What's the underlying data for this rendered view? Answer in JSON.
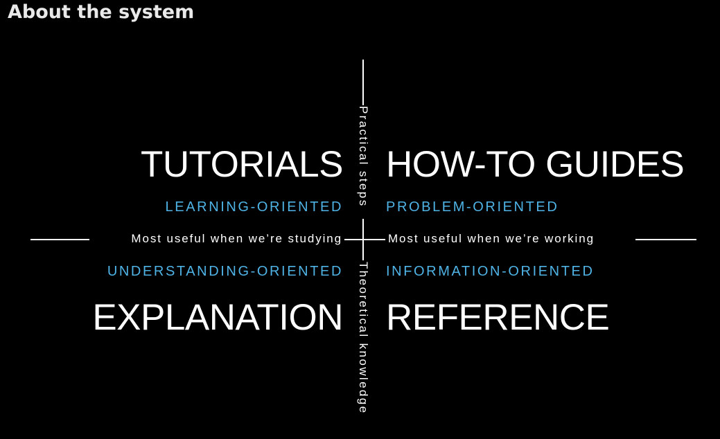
{
  "page": {
    "title": "About the system"
  },
  "diagram": {
    "quadrants": {
      "top_left": {
        "title": "TUTORIALS",
        "orientation": "LEARNING-ORIENTED"
      },
      "top_right": {
        "title": "HOW-TO GUIDES",
        "orientation": "PROBLEM-ORIENTED"
      },
      "bottom_left": {
        "title": "EXPLANATION",
        "orientation": "UNDERSTANDING-ORIENTED"
      },
      "bottom_right": {
        "title": "REFERENCE",
        "orientation": "INFORMATION-ORIENTED"
      }
    },
    "axes": {
      "top": "Practical steps",
      "bottom": "Theoretical knowledge",
      "left": "Most useful when we’re studying",
      "right": "Most useful when we’re working"
    },
    "colors": {
      "background": "#000000",
      "title_text": "#ffffff",
      "orientation_text": "#4fb3e5",
      "axis_lines": "#ffffff"
    }
  }
}
